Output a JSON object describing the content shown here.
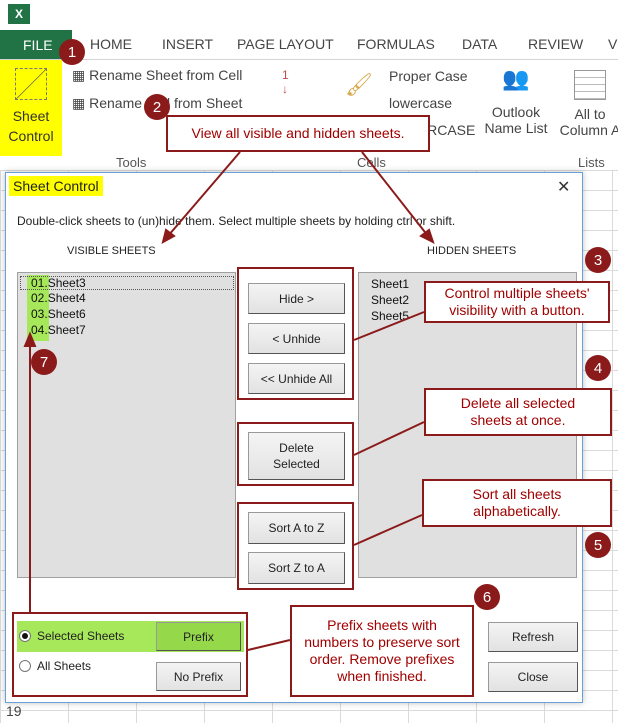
{
  "app": {
    "icon": "excel-icon"
  },
  "tabs": [
    "FILE",
    "HOME",
    "INSERT",
    "PAGE LAYOUT",
    "FORMULAS",
    "DATA",
    "REVIEW",
    "V"
  ],
  "ribbon": {
    "sheet_control": "Sheet Control",
    "rename_from_cell": "Rename Sheet from Cell",
    "rename_from_sheet": "Rename Cell from Sheet",
    "proper_case": "Proper Case",
    "lowercase": "lowercase",
    "uppercase": "UPPERCASE",
    "outlook": "Outlook Name List",
    "all_to_column": "All to Column A",
    "groups": [
      "Tools",
      "Cells",
      "Lists"
    ]
  },
  "dialog": {
    "title": "Sheet Control",
    "instructions": "Double-click sheets to (un)hide them. Select multiple sheets by holding ctrl or shift.",
    "visible_header": "VISIBLE SHEETS",
    "hidden_header": "HIDDEN SHEETS",
    "visible": [
      {
        "prefix": "01.",
        "name": "Sheet3"
      },
      {
        "prefix": "02.",
        "name": "Sheet4"
      },
      {
        "prefix": "03.",
        "name": "Sheet6"
      },
      {
        "prefix": "04.",
        "name": "Sheet7"
      }
    ],
    "hidden": [
      "Sheet1",
      "Sheet2",
      "Sheet5"
    ],
    "buttons": {
      "hide": "Hide >",
      "unhide": "< Unhide",
      "unhide_all": "<< Unhide All",
      "delete": "Delete Selected",
      "sort_az": "Sort A to Z",
      "sort_za": "Sort Z to A",
      "prefix": "Prefix",
      "no_prefix": "No Prefix",
      "refresh": "Refresh",
      "close": "Close"
    },
    "radios": {
      "selected": "Selected Sheets",
      "all": "All Sheets",
      "checked": "selected"
    }
  },
  "callouts": {
    "c2": "View all visible and hidden sheets.",
    "c3": "Control multiple sheets' visibility with a button.",
    "c4": "Delete all selected sheets at once.",
    "c5": "Sort all sheets alphabetically.",
    "c6": "Prefix sheets with numbers to preserve sort order. Remove prefixes when finished."
  },
  "numbers": [
    "1",
    "2",
    "3",
    "4",
    "5",
    "6",
    "7"
  ],
  "row_label": "19",
  "colors": {
    "annotation": "#8b1a1a",
    "highlight_yellow": "#ffff00",
    "highlight_green": "#a6e85a",
    "excel_green": "#217346"
  }
}
